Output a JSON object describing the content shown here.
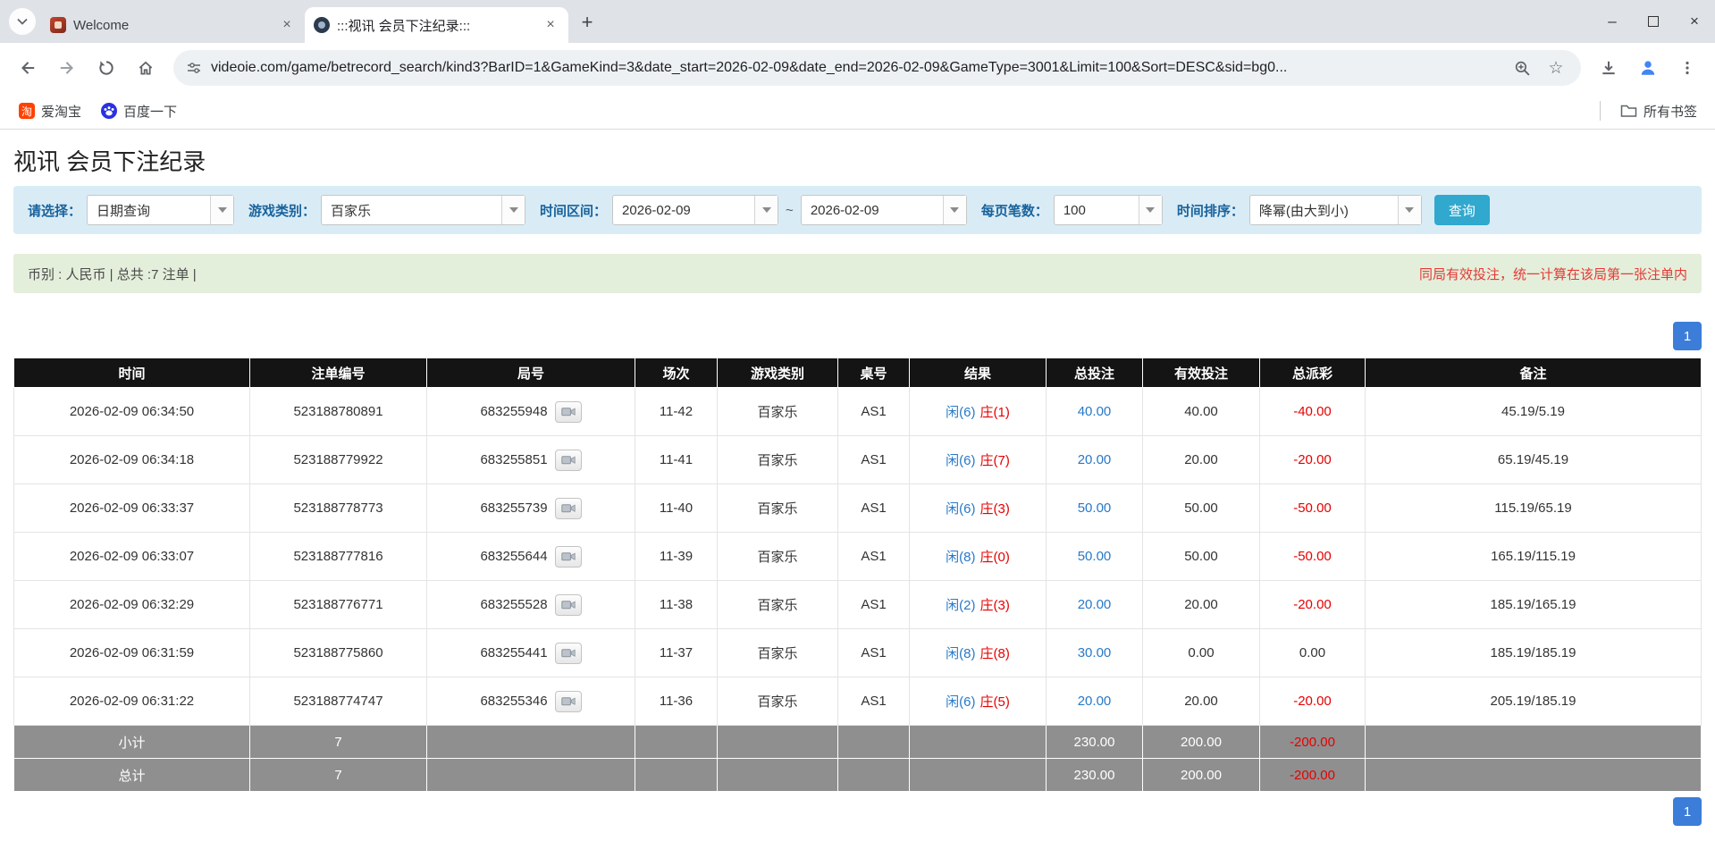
{
  "theme": {
    "accent-blue": "#3b7dd8",
    "link-blue": "#2779c8",
    "player-blue": "#2779c8",
    "banker-red": "#e60000",
    "negative-red": "#e60000",
    "filter-bg": "#d9ecf6",
    "filter-label": "#1a639c",
    "notice-bg": "#e4efdb",
    "notice-red": "#e53935",
    "search-btn": "#31a8ce",
    "table-header-bg": "#141414",
    "summary-bg": "#8f8f8f"
  },
  "browser": {
    "tabs": [
      {
        "title": "Welcome"
      },
      {
        "title": ":::视讯 会员下注纪录:::"
      }
    ],
    "url": "videoie.com/game/betrecord_search/kind3?BarID=1&GameKind=3&date_start=2026-02-09&date_end=2026-02-09&GameType=3001&Limit=100&Sort=DESC&sid=bg0...",
    "bookmarks": [
      {
        "label": "爱淘宝",
        "glyph": "淘"
      },
      {
        "label": "百度一下"
      }
    ],
    "all_bookmarks": "所有书签"
  },
  "page": {
    "title": "视讯 会员下注纪录",
    "filters": {
      "select_label": "请选择：",
      "select_value": "日期查询",
      "game_label": "游戏类别：",
      "game_value": "百家乐",
      "range_label": "时间区间：",
      "date_start": "2026-02-09",
      "tilde": "~",
      "date_end": "2026-02-09",
      "per_page_label": "每页笔数：",
      "per_page_value": "100",
      "sort_label": "时间排序：",
      "sort_value": "降幂(由大到小)",
      "search_button": "查询"
    },
    "notice": {
      "left": "币别 : 人民币 | 总共 :7 注单 |",
      "right": "同局有效投注，统一计算在该局第一张注单内"
    },
    "pagination": {
      "page": "1"
    },
    "table": {
      "headers": [
        "时间",
        "注单编号",
        "局号",
        "场次",
        "游戏类别",
        "桌号",
        "结果",
        "总投注",
        "有效投注",
        "总派彩",
        "备注"
      ],
      "rows": [
        {
          "time": "2026-02-09 06:34:50",
          "bet_id": "523188780891",
          "round": "683255948",
          "session": "11-42",
          "game": "百家乐",
          "table_no": "AS1",
          "result_player": "闲(6)",
          "result_banker": "庄(1)",
          "total_bet": "40.00",
          "valid_bet": "40.00",
          "payout": "-40.00",
          "remark": "45.19/5.19"
        },
        {
          "time": "2026-02-09 06:34:18",
          "bet_id": "523188779922",
          "round": "683255851",
          "session": "11-41",
          "game": "百家乐",
          "table_no": "AS1",
          "result_player": "闲(6)",
          "result_banker": "庄(7)",
          "total_bet": "20.00",
          "valid_bet": "20.00",
          "payout": "-20.00",
          "remark": "65.19/45.19"
        },
        {
          "time": "2026-02-09 06:33:37",
          "bet_id": "523188778773",
          "round": "683255739",
          "session": "11-40",
          "game": "百家乐",
          "table_no": "AS1",
          "result_player": "闲(6)",
          "result_banker": "庄(3)",
          "total_bet": "50.00",
          "valid_bet": "50.00",
          "payout": "-50.00",
          "remark": "115.19/65.19"
        },
        {
          "time": "2026-02-09 06:33:07",
          "bet_id": "523188777816",
          "round": "683255644",
          "session": "11-39",
          "game": "百家乐",
          "table_no": "AS1",
          "result_player": "闲(8)",
          "result_banker": "庄(0)",
          "total_bet": "50.00",
          "valid_bet": "50.00",
          "payout": "-50.00",
          "remark": "165.19/115.19"
        },
        {
          "time": "2026-02-09 06:32:29",
          "bet_id": "523188776771",
          "round": "683255528",
          "session": "11-38",
          "game": "百家乐",
          "table_no": "AS1",
          "result_player": "闲(2)",
          "result_banker": "庄(3)",
          "total_bet": "20.00",
          "valid_bet": "20.00",
          "payout": "-20.00",
          "remark": "185.19/165.19"
        },
        {
          "time": "2026-02-09 06:31:59",
          "bet_id": "523188775860",
          "round": "683255441",
          "session": "11-37",
          "game": "百家乐",
          "table_no": "AS1",
          "result_player": "闲(8)",
          "result_banker": "庄(8)",
          "total_bet": "30.00",
          "valid_bet": "0.00",
          "payout": "0.00",
          "remark": "185.19/185.19"
        },
        {
          "time": "2026-02-09 06:31:22",
          "bet_id": "523188774747",
          "round": "683255346",
          "session": "11-36",
          "game": "百家乐",
          "table_no": "AS1",
          "result_player": "闲(6)",
          "result_banker": "庄(5)",
          "total_bet": "20.00",
          "valid_bet": "20.00",
          "payout": "-20.00",
          "remark": "205.19/185.19"
        }
      ],
      "subtotal": {
        "label": "小计",
        "count": "7",
        "total_bet": "230.00",
        "valid_bet": "200.00",
        "payout": "-200.00"
      },
      "total": {
        "label": "总计",
        "count": "7",
        "total_bet": "230.00",
        "valid_bet": "200.00",
        "payout": "-200.00"
      }
    }
  }
}
